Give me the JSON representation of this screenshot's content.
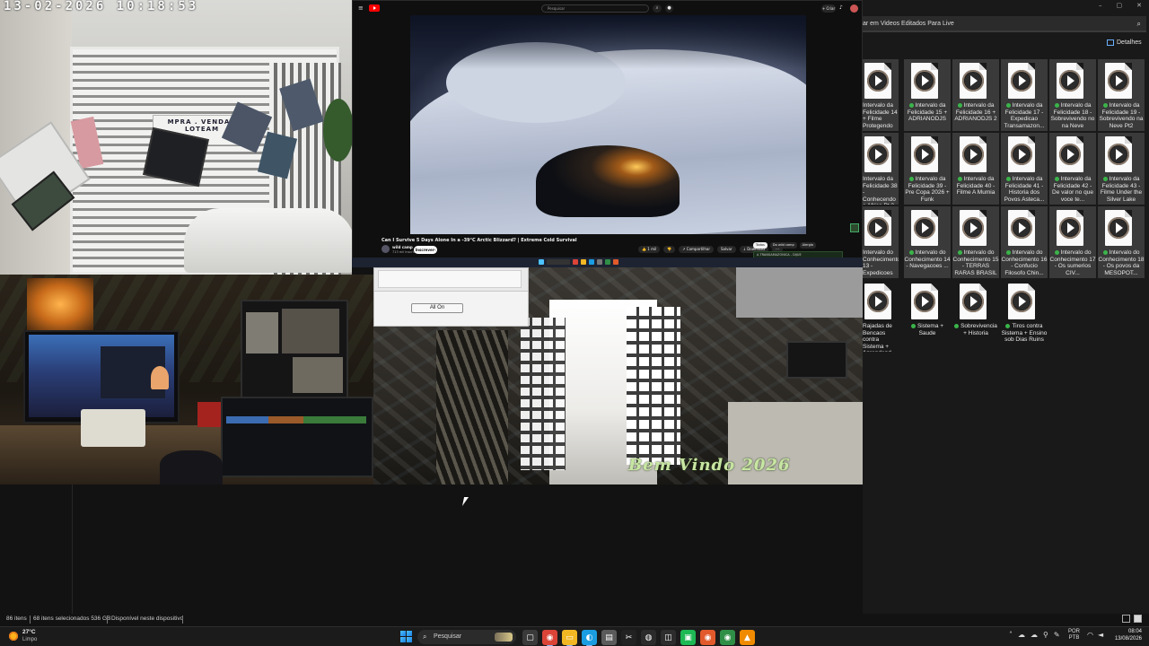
{
  "camera_gate": {
    "timestamp": "13-02-2026  10:18:53",
    "sign_text": "MPRA . VENDA . LOTEAM"
  },
  "youtube": {
    "search_placeholder": "Pesquisar",
    "search_icon": "search-icon",
    "mic_icon": "mic-icon",
    "create_label": "+ Criar",
    "video_title": "Can I Survive 5 Days Alone In a -39°C Arctic Blizzard? | Extreme Cold Survival",
    "channel_name": "wild camp",
    "subscribers": "713 mil inscritos",
    "join_label": "Inscrever-se",
    "actions": [
      "👍 1 mil",
      "👎",
      "↗ Compartilhar",
      "Salvar",
      "↓ Download",
      "···"
    ],
    "filter_chips": [
      "Todos",
      "Do wild camp",
      "Alergia"
    ],
    "recommendation_text": "A TRANSAMAZONICA - DIJUE"
  },
  "hall_camera": {
    "watermark": "Bem Vindo 2026",
    "all_on_button": "All On"
  },
  "explorer": {
    "search_text": "ar em Videos Editados Para Live",
    "search_icon": "search-icon",
    "details_label": "Detalhes",
    "files": [
      {
        "name": "Intervalo da Felicidade 14 + Filme Protegendo ...",
        "synced": false,
        "selected": true
      },
      {
        "name": "Intervalo da Felicidade 15 + ADRIANODJS",
        "synced": true,
        "selected": true
      },
      {
        "name": "Intervalo da Felicidade 16 + ADRIANODJS 2",
        "synced": true,
        "selected": true
      },
      {
        "name": "Intervalo da Felicidade 17 - Expedicao Transamazon...",
        "synced": true,
        "selected": true
      },
      {
        "name": "Intervalo da Felicidade 18 - Sobrevivendo no na Neve",
        "synced": true,
        "selected": true
      },
      {
        "name": "Intervalo da Felicidade 19 - Sobrevivendo na Neve Pt2",
        "synced": true,
        "selected": true
      },
      {
        "name": "Intervalo da Felicidade 38 - Conhecendo a Africa Pt 3",
        "synced": false,
        "selected": true
      },
      {
        "name": "Intervalo da Felicidade 39 - Pre Copa 2026 + Funk",
        "synced": true,
        "selected": true
      },
      {
        "name": "Intervalo da Felicidade 40 - Filme A Mumia",
        "synced": true,
        "selected": true
      },
      {
        "name": "Intervalo da Felicidade 41 - Historia dos Povos Asteca...",
        "synced": true,
        "selected": true
      },
      {
        "name": "Intervalo da Felicidade 42 - De valor no que voce te...",
        "synced": true,
        "selected": true
      },
      {
        "name": "Intervalo da Felicidade 43 - Filme Under the Silver Lake",
        "synced": true,
        "selected": true
      },
      {
        "name": "Intervalo do Conhecimento 13 - Expedicoes ...",
        "synced": false,
        "selected": true
      },
      {
        "name": "Intervalo do Conhecimento 14 - Navegacoes ...",
        "synced": true,
        "selected": true
      },
      {
        "name": "Intervalo do Conhecimento 15 - TERRAS RARAS BRASIL",
        "synced": true,
        "selected": true
      },
      {
        "name": "Intervalo do Conhecimento 16 - Confucio Filosofo Chin...",
        "synced": true,
        "selected": true
      },
      {
        "name": "Intervalo do Conhecimento 17 - Os sumerios CIV...",
        "synced": true,
        "selected": true
      },
      {
        "name": "Intervalo do Conhecimento 18 - Os povos da MESOPOT...",
        "synced": true,
        "selected": true
      },
      {
        "name": "Rajadas de Bencaos contra Sistema + Aprendend...",
        "synced": false,
        "selected": false
      },
      {
        "name": "Sistema + Saude",
        "synced": true,
        "selected": false
      },
      {
        "name": "Sobrevivencia + Historia",
        "synced": true,
        "selected": false
      },
      {
        "name": "Tiros contra Sistema + Ensino sob Dias Ruins",
        "synced": true,
        "selected": false
      }
    ]
  },
  "statusbar": {
    "item_count": "86 itens",
    "selected": "68 itens selecionados  536 GB",
    "availability": "Disponível neste dispositivo"
  },
  "taskbar": {
    "weather_temp": "27°C",
    "weather_desc": "Limpo",
    "search_label": "Pesquisar",
    "apps": [
      {
        "icon": "task-view-icon",
        "color": "#3a3a3a",
        "glyph": "▢"
      },
      {
        "icon": "chrome-icon",
        "color": "#db4437",
        "glyph": "◉"
      },
      {
        "icon": "file-explorer-icon",
        "color": "#f2b824",
        "glyph": "▭"
      },
      {
        "icon": "edge-icon",
        "color": "#1b9de2",
        "glyph": "◐"
      },
      {
        "icon": "store-icon",
        "color": "#5b5b5b",
        "glyph": "▤"
      },
      {
        "icon": "capcut-icon",
        "color": "#222222",
        "glyph": "✂"
      },
      {
        "icon": "obs-icon",
        "color": "#2b2b2b",
        "glyph": "◍"
      },
      {
        "icon": "camera-app-icon",
        "color": "#2d2d2d",
        "glyph": "◫"
      },
      {
        "icon": "green-app-icon",
        "color": "#1db954",
        "glyph": "▣"
      },
      {
        "icon": "chrome-profile-icon",
        "color": "#e25a2b",
        "glyph": "◉"
      },
      {
        "icon": "chrome-beta-icon",
        "color": "#2f8f46",
        "glyph": "◉"
      },
      {
        "icon": "vlc-icon",
        "color": "#f08a00",
        "glyph": "▲"
      }
    ],
    "lang_line1": "POR",
    "lang_line2": "PTB",
    "time": "08:04",
    "date": "13/08/2026"
  }
}
